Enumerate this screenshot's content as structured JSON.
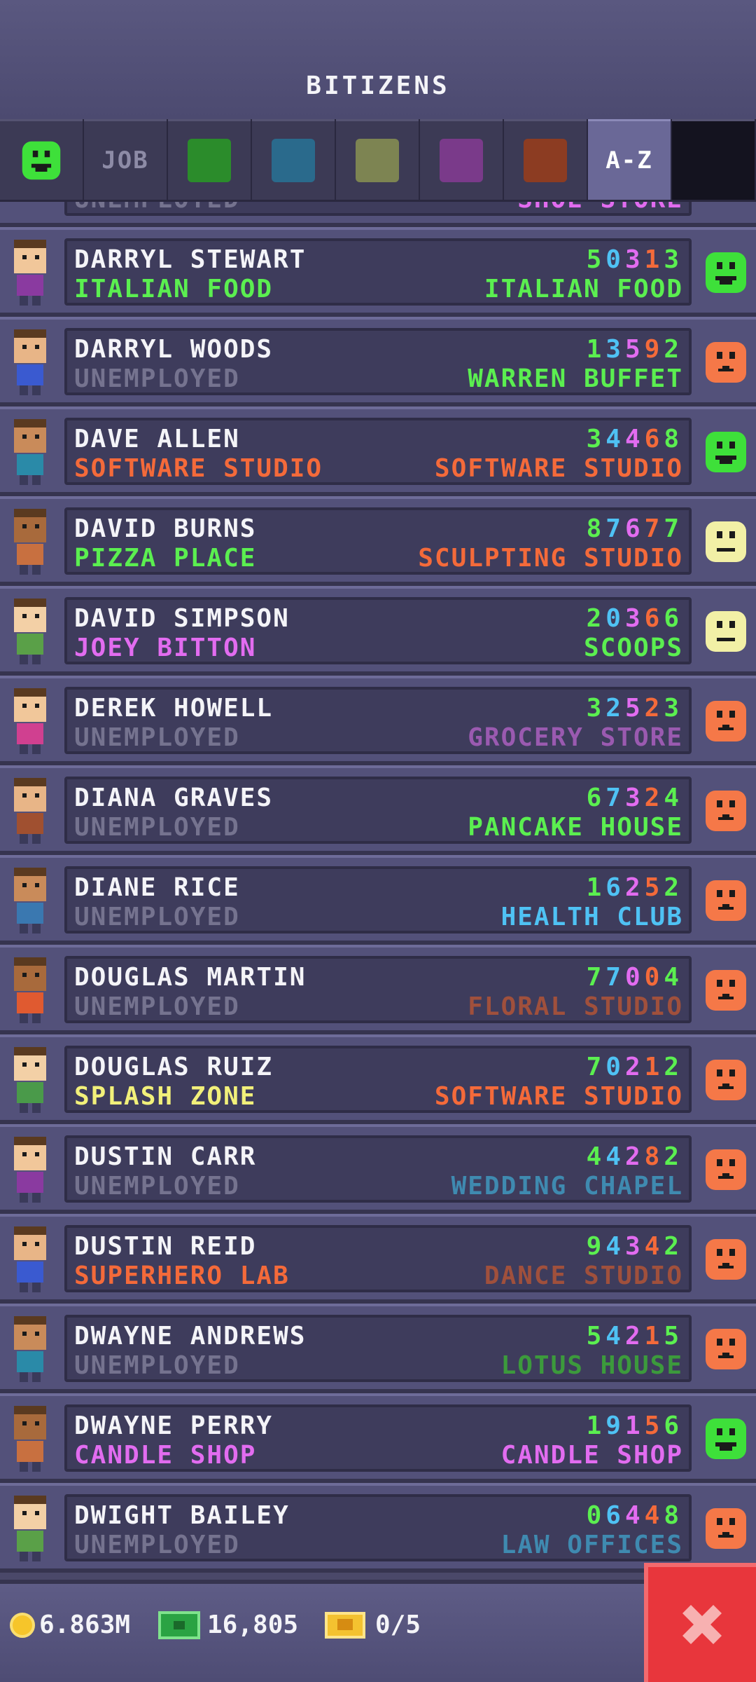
{
  "header": {
    "title": "BITIZENS"
  },
  "tabs": [
    {
      "id": "mood",
      "label": "",
      "icon": "happy-face-icon",
      "color": "#3ec23c"
    },
    {
      "id": "job",
      "label": "JOB"
    },
    {
      "id": "green",
      "label": "",
      "color": "#2b8c2b"
    },
    {
      "id": "blue",
      "label": "",
      "color": "#2a6a8c"
    },
    {
      "id": "olive",
      "label": "",
      "color": "#7d8452"
    },
    {
      "id": "purple",
      "label": "",
      "color": "#7a3a8a"
    },
    {
      "id": "orange",
      "label": "",
      "color": "#8c3c22"
    },
    {
      "id": "az",
      "label": "A-Z",
      "active": true
    }
  ],
  "partial_row": {
    "job": "UNEMPLOYED",
    "dream": "SHOE STORE"
  },
  "bitizens": [
    {
      "name": "DARRYL STEWART",
      "job": "ITALIAN FOOD",
      "job_color": "#5bef50",
      "number": "50313",
      "dream": "ITALIAN FOOD",
      "dream_color": "#5bef50",
      "mood": "happy"
    },
    {
      "name": "DARRYL WOODS",
      "job": "UNEMPLOYED",
      "job_color": "#75738f",
      "number": "13592",
      "dream": "WARREN BUFFET",
      "dream_color": "#5bef50",
      "mood": "sad"
    },
    {
      "name": "DAVE ALLEN",
      "job": "SOFTWARE STUDIO",
      "job_color": "#f46a3a",
      "number": "34468",
      "dream": "SOFTWARE STUDIO",
      "dream_color": "#f46a3a",
      "mood": "happy"
    },
    {
      "name": "DAVID BURNS",
      "job": "PIZZA PLACE",
      "job_color": "#5bef50",
      "number": "87677",
      "dream": "SCULPTING STUDIO",
      "dream_color": "#f46a3a",
      "mood": "neutral"
    },
    {
      "name": "DAVID SIMPSON",
      "job": "JOEY BITTON",
      "job_color": "#e26cf0",
      "number": "20366",
      "dream": "SCOOPS",
      "dream_color": "#5bef50",
      "mood": "neutral"
    },
    {
      "name": "DEREK HOWELL",
      "job": "UNEMPLOYED",
      "job_color": "#75738f",
      "number": "32523",
      "dream": "GROCERY STORE",
      "dream_color": "#9a5ab0",
      "mood": "sad"
    },
    {
      "name": "DIANA GRAVES",
      "job": "UNEMPLOYED",
      "job_color": "#75738f",
      "number": "67324",
      "dream": "PANCAKE HOUSE",
      "dream_color": "#5bef50",
      "mood": "sad"
    },
    {
      "name": "DIANE RICE",
      "job": "UNEMPLOYED",
      "job_color": "#75738f",
      "number": "16252",
      "dream": "HEALTH CLUB",
      "dream_color": "#4fc2f4",
      "mood": "sad"
    },
    {
      "name": "DOUGLAS MARTIN",
      "job": "UNEMPLOYED",
      "job_color": "#75738f",
      "number": "77004",
      "dream": "FLORAL STUDIO",
      "dream_color": "#a0503c",
      "mood": "sad"
    },
    {
      "name": "DOUGLAS RUIZ",
      "job": "SPLASH ZONE",
      "job_color": "#f2f07a",
      "number": "70212",
      "dream": "SOFTWARE STUDIO",
      "dream_color": "#f46a3a",
      "mood": "sad"
    },
    {
      "name": "DUSTIN CARR",
      "job": "UNEMPLOYED",
      "job_color": "#75738f",
      "number": "44282",
      "dream": "WEDDING CHAPEL",
      "dream_color": "#3f8ab0",
      "mood": "sad"
    },
    {
      "name": "DUSTIN REID",
      "job": "SUPERHERO LAB",
      "job_color": "#f46a3a",
      "number": "94342",
      "dream": "DANCE STUDIO",
      "dream_color": "#a0503c",
      "mood": "sad"
    },
    {
      "name": "DWAYNE ANDREWS",
      "job": "UNEMPLOYED",
      "job_color": "#75738f",
      "number": "54215",
      "dream": "LOTUS HOUSE",
      "dream_color": "#3c9a3c",
      "mood": "sad"
    },
    {
      "name": "DWAYNE PERRY",
      "job": "CANDLE SHOP",
      "job_color": "#e26cf0",
      "number": "19156",
      "dream": "CANDLE SHOP",
      "dream_color": "#e26cf0",
      "mood": "happy"
    },
    {
      "name": "DWIGHT BAILEY",
      "job": "UNEMPLOYED",
      "job_color": "#75738f",
      "number": "06448",
      "dream": "LAW OFFICES",
      "dream_color": "#3f8ab0",
      "mood": "sad"
    }
  ],
  "footer": {
    "coins": "6.863M",
    "bux": "16,805",
    "tickets": "0/5"
  },
  "colors": {
    "happy": "#3ee03a",
    "neutral": "#f2f0a6",
    "sad": "#f57848"
  }
}
